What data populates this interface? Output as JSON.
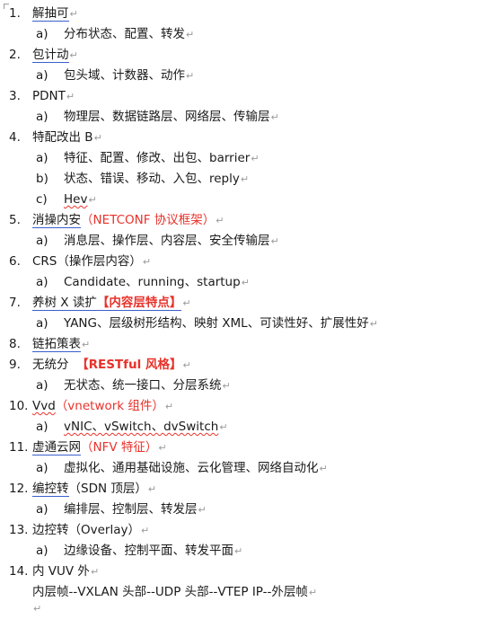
{
  "pilcrow": "↵",
  "items": [
    {
      "num": "1.",
      "text": "解抽可"
    },
    {
      "sub": "a)",
      "text": "分布状态、配置、转发"
    },
    {
      "num": "2.",
      "text": "包计动"
    },
    {
      "sub": "a)",
      "text": "包头域、计数器、动作"
    },
    {
      "num": "3.",
      "text": "PDNT"
    },
    {
      "sub": "a)",
      "text": "物理层、数据链路层、网络层、传输层"
    },
    {
      "num": "4.",
      "text": "特配改出 B"
    },
    {
      "sub": "a)",
      "text": "特征、配置、修改、出包、barrier"
    },
    {
      "sub": "b)",
      "text": "状态、错误、移动、入包、reply"
    },
    {
      "sub": "c)",
      "text": "Hev"
    },
    {
      "num": "5.",
      "text_a": "消操内安",
      "text_b": "（NETCONF 协议框架）"
    },
    {
      "sub": "a)",
      "text": "消息层、操作层、内容层、安全传输层"
    },
    {
      "num": "6.",
      "text": "CRS（操作层内容）"
    },
    {
      "sub": "a)",
      "text": "Candidate、running、startup"
    },
    {
      "num": "7.",
      "text_a": "养树 X 读扩",
      "text_b": "【内容层特点】"
    },
    {
      "sub": "a)",
      "text": "YANG、层级树形结构、映射 XML、可读性好、扩展性好"
    },
    {
      "num": "8.",
      "text": "链拓策表"
    },
    {
      "num": "9.",
      "text_a": "无统分",
      "text_b": "【RESTful 风格】"
    },
    {
      "sub": "a)",
      "text": "无状态、统一接口、分层系统"
    },
    {
      "num": "10.",
      "text_a": "Vvd",
      "text_b": "（vnetwork 组件）"
    },
    {
      "sub": "a)",
      "text": "vNIC、vSwitch、dvSwitch"
    },
    {
      "num": "11.",
      "text_a": "虚通云网",
      "text_b": "（NFV 特征）"
    },
    {
      "sub": "a)",
      "text": "虚拟化、通用基础设施、云化管理、网络自动化"
    },
    {
      "num": "12.",
      "text_a": "编控转",
      "text_b": "（SDN 顶层）"
    },
    {
      "sub": "a)",
      "text": "编排层、控制层、转发层"
    },
    {
      "num": "13.",
      "text": "边控转（Overlay）"
    },
    {
      "sub": "a)",
      "text": "边缘设备、控制平面、转发平面"
    },
    {
      "num": "14.",
      "text": "内 VUV 外"
    },
    {
      "text": "内层帧--VXLAN 头部--UDP 头部--VTEP IP--外层帧"
    }
  ]
}
